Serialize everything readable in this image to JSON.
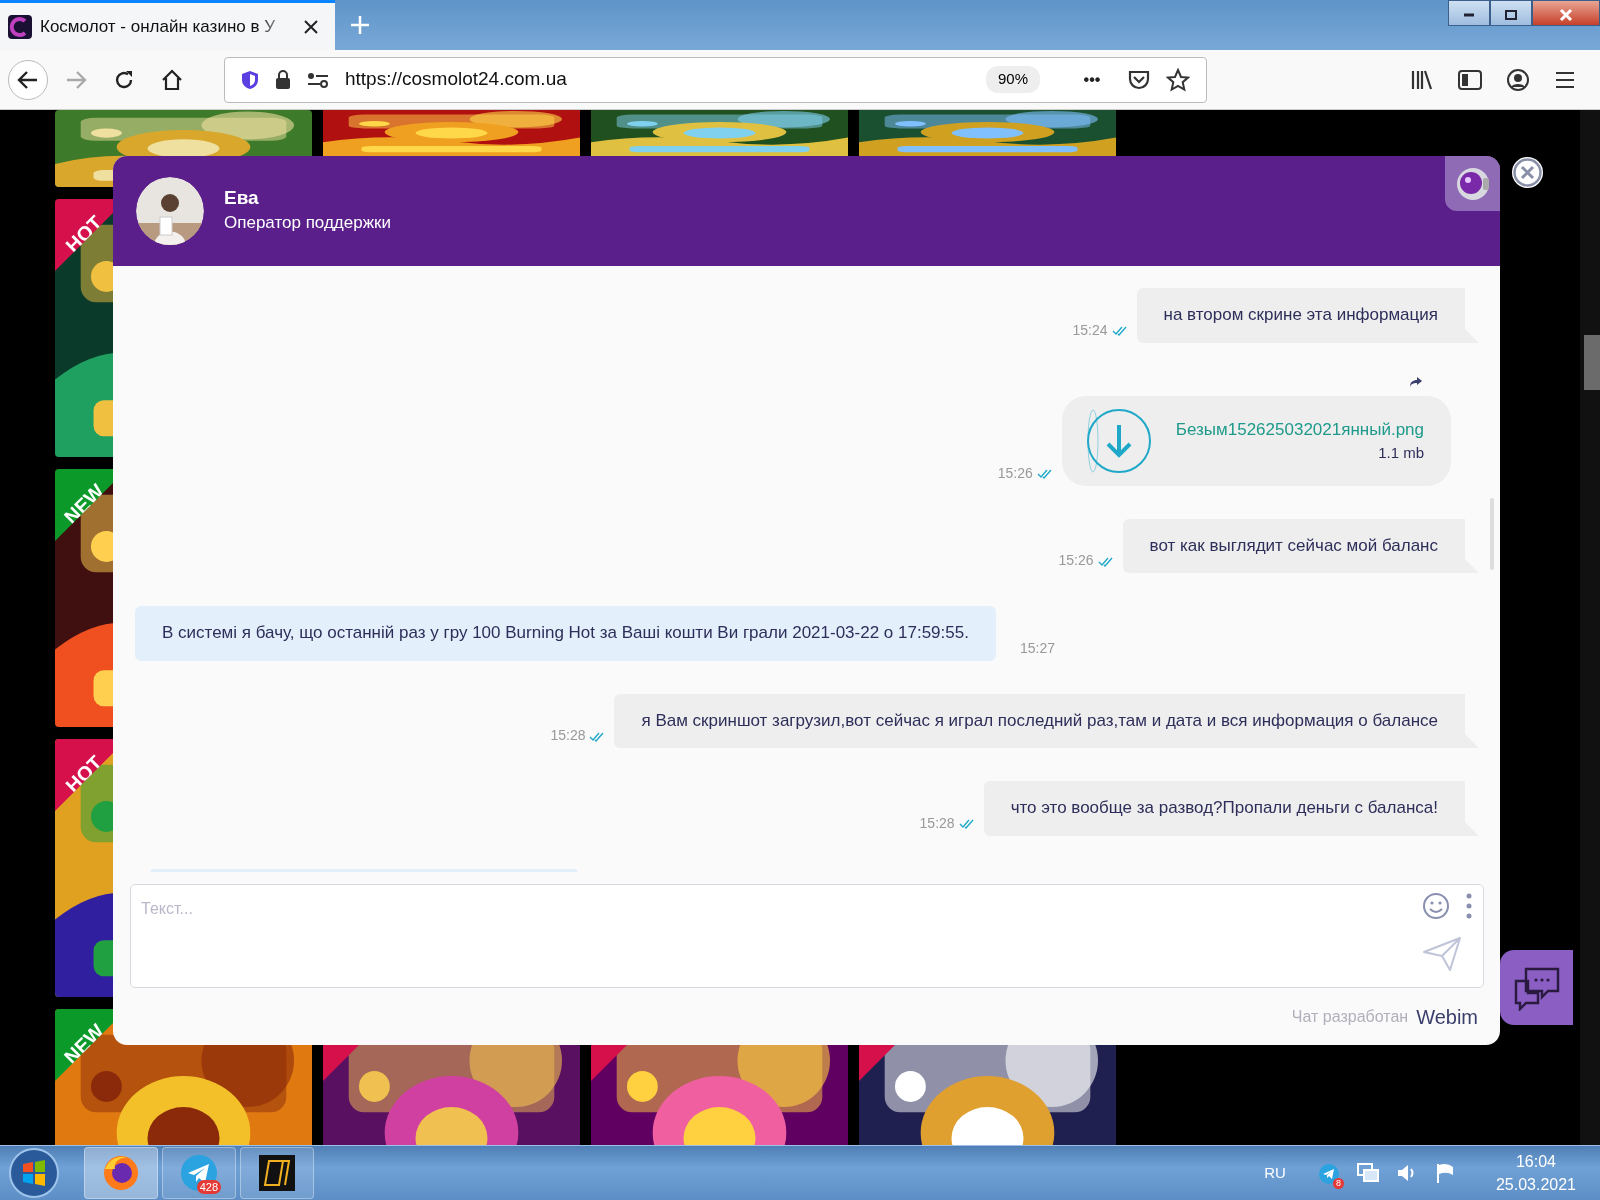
{
  "browser": {
    "tab_title": "Космолот - онлайн казино в У",
    "url": "https://cosmolot24.com.ua",
    "zoom": "90%",
    "more": "•••"
  },
  "game_tiles": [
    {
      "kind": "picture"
    },
    {
      "kind": "picture"
    },
    {
      "kind": "picture"
    },
    {
      "kind": "picture"
    },
    {
      "kind": "picture",
      "badge": {
        "label": "HOT",
        "color": "#d5104b"
      }
    },
    {
      "kind": "picture",
      "badge": {
        "label": "NEW",
        "color": "#0b9a2a"
      }
    },
    {
      "kind": "picture",
      "badge": {
        "label": "HOT",
        "color": "#d5104b"
      }
    },
    {
      "kind": "picture",
      "badge": {
        "label": "NEW",
        "color": "#0b9a2a"
      }
    },
    {
      "kind": "picture",
      "badge": {
        "color": "#d5104b"
      }
    },
    {
      "kind": "picture",
      "badge": {
        "color": "#d5104b"
      }
    },
    {
      "kind": "picture",
      "badge": {
        "color": "#d5104b"
      }
    }
  ],
  "chat": {
    "operator_name": "Ева",
    "operator_role": "Оператор поддержки",
    "messages": [
      {
        "kind": "sent",
        "text": "на втором скрине эта информация",
        "time": "15:24",
        "read": true
      },
      {
        "kind": "file",
        "file_name": "Безым152625032021янный.png",
        "file_size": "1.1 mb",
        "time": "15:26",
        "read": true
      },
      {
        "kind": "sent",
        "text": "вот как выглядит сейчас мой баланс",
        "time": "15:26",
        "read": true
      },
      {
        "kind": "received",
        "text": "В системі я бачу, що останній раз у гру 100 Burning Hot за Ваші кошти Ви грали 2021-03-22 о 17:59:55.",
        "time": "15:27"
      },
      {
        "kind": "sent",
        "text": "я Вам скриншот загрузил,вот сейчас я играл последний раз,там и дата и вся информация о балансе",
        "time": "15:28",
        "read": true
      },
      {
        "kind": "sent",
        "text": "что это вообще за развод?Пропали деньги с баланса!",
        "time": "15:28",
        "read": true
      },
      {
        "kind": "partial"
      }
    ],
    "input": {
      "placeholder": "Текст..."
    },
    "footer": {
      "label": "Чат разработан",
      "brand": "Webim"
    }
  },
  "taskbar": {
    "apps": [
      {
        "kind": "firefox",
        "selected": true
      },
      {
        "kind": "telegram",
        "selected": false,
        "badge": "428"
      },
      {
        "kind": "app",
        "selected": false
      }
    ],
    "language": "RU",
    "tray_badge": "8",
    "time": "16:04",
    "date": "25.03.2021"
  }
}
